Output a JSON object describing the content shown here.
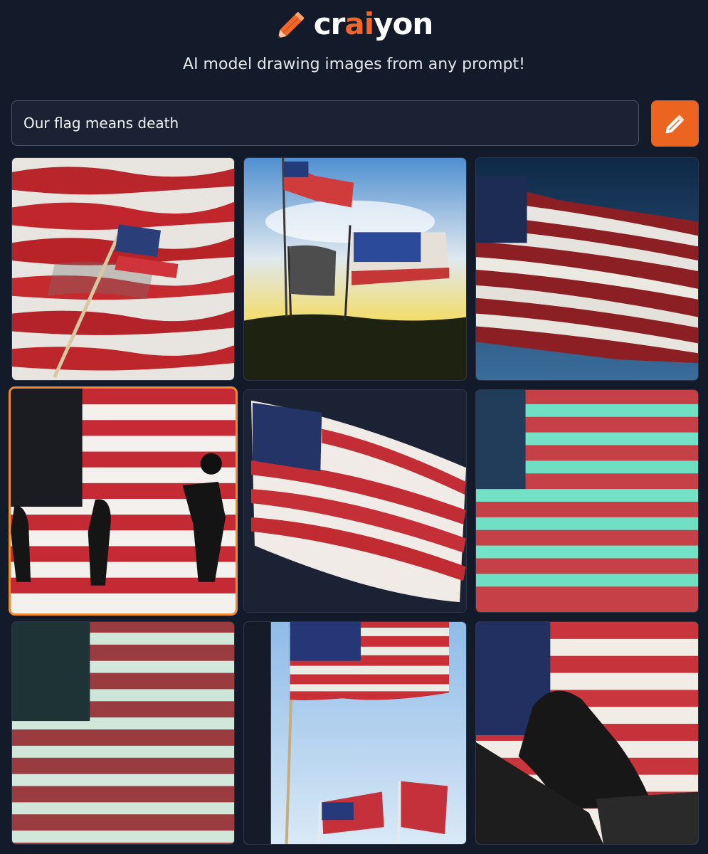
{
  "app": {
    "logo_prefix": "cr",
    "logo_ai": "ai",
    "logo_suffix": "yon",
    "tagline": "AI model drawing images from any prompt!"
  },
  "search": {
    "value": "Our flag means death",
    "placeholder": ""
  },
  "colors": {
    "background": "#131a2a",
    "accent": "#eb6420",
    "selected_border": "#f08a2f"
  },
  "icons": {
    "logo": "pencil-icon",
    "draw_button": "pencil-icon"
  },
  "results": {
    "count": 9,
    "selected_index": 3
  }
}
